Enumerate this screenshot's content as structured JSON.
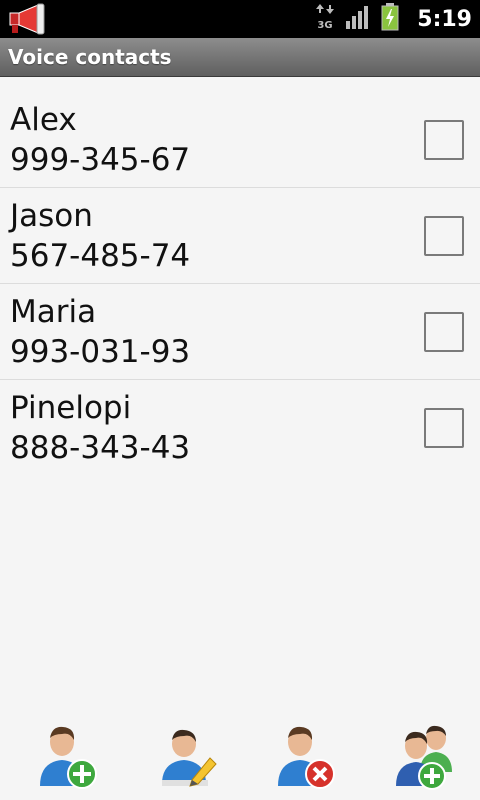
{
  "status_bar": {
    "network": "3G",
    "time": "5:19"
  },
  "header": {
    "title": "Voice contacts"
  },
  "contacts": [
    {
      "name": "Alex",
      "phone": "999-345-67",
      "checked": false
    },
    {
      "name": "Jason",
      "phone": "567-485-74",
      "checked": false
    },
    {
      "name": "Maria",
      "phone": "993-031-93",
      "checked": false
    },
    {
      "name": "Pinelopi",
      "phone": "888-343-43",
      "checked": false
    }
  ],
  "toolbar": {
    "buttons": [
      {
        "icon": "add-contact-icon"
      },
      {
        "icon": "edit-contact-icon"
      },
      {
        "icon": "delete-contact-icon"
      },
      {
        "icon": "add-group-icon"
      }
    ]
  },
  "colors": {
    "status_bar_bg": "#000000",
    "title_bar_bg": "#757575",
    "list_bg": "#f5f5f5",
    "battery_green": "#8ac43f",
    "add_green": "#3ea83e",
    "delete_red": "#d6322b"
  }
}
